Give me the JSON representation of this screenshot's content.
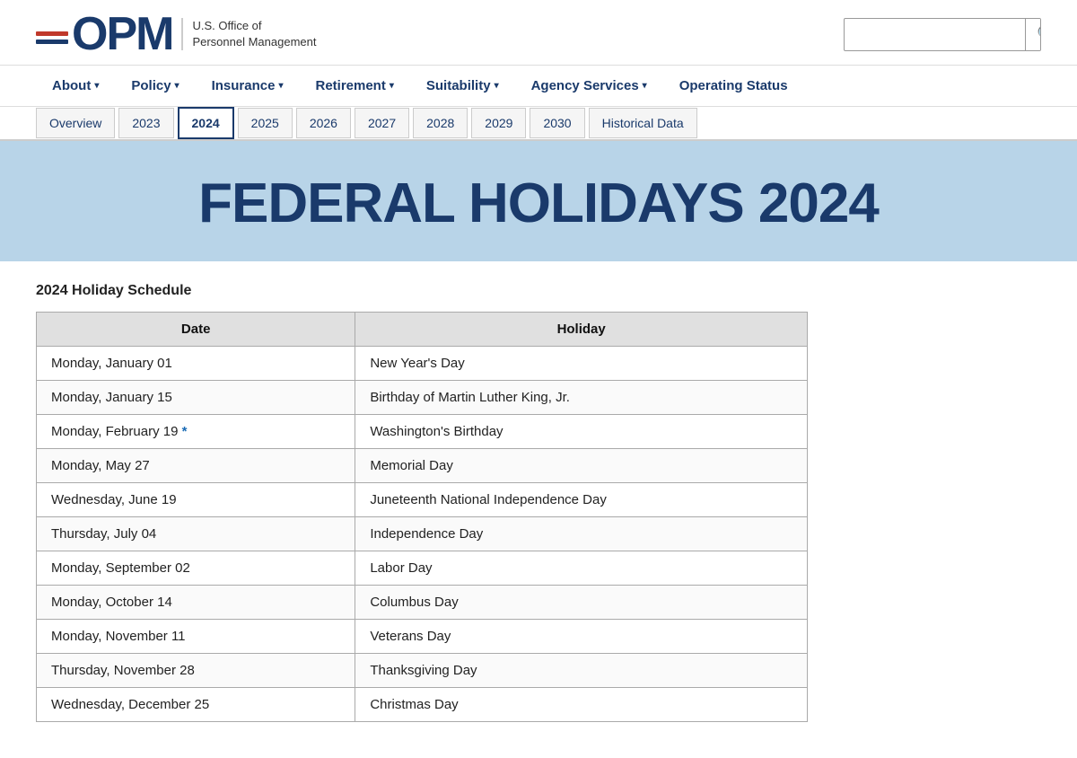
{
  "header": {
    "logo_text": "OPM",
    "tagline_line1": "U.S. Office of",
    "tagline_line2": "Personnel Management",
    "search_placeholder": "",
    "search_icon": "🔍"
  },
  "nav": {
    "items": [
      {
        "id": "about",
        "label": "About",
        "hasDropdown": true
      },
      {
        "id": "policy",
        "label": "Policy",
        "hasDropdown": true
      },
      {
        "id": "insurance",
        "label": "Insurance",
        "hasDropdown": true
      },
      {
        "id": "retirement",
        "label": "Retirement",
        "hasDropdown": true
      },
      {
        "id": "suitability",
        "label": "Suitability",
        "hasDropdown": true
      },
      {
        "id": "agency-services",
        "label": "Agency Services",
        "hasDropdown": true
      },
      {
        "id": "operating-status",
        "label": "Operating Status",
        "hasDropdown": false
      }
    ]
  },
  "sub_nav": {
    "tabs": [
      {
        "id": "overview",
        "label": "Overview",
        "active": false
      },
      {
        "id": "2023",
        "label": "2023",
        "active": false
      },
      {
        "id": "2024",
        "label": "2024",
        "active": true
      },
      {
        "id": "2025",
        "label": "2025",
        "active": false
      },
      {
        "id": "2026",
        "label": "2026",
        "active": false
      },
      {
        "id": "2027",
        "label": "2027",
        "active": false
      },
      {
        "id": "2028",
        "label": "2028",
        "active": false
      },
      {
        "id": "2029",
        "label": "2029",
        "active": false
      },
      {
        "id": "2030",
        "label": "2030",
        "active": false
      },
      {
        "id": "historical-data",
        "label": "Historical Data",
        "active": false
      }
    ]
  },
  "hero": {
    "title": "FEDERAL HOLIDAYS 2024"
  },
  "content": {
    "schedule_title": "2024 Holiday Schedule",
    "table": {
      "col_date": "Date",
      "col_holiday": "Holiday",
      "rows": [
        {
          "date": "Monday, January 01",
          "holiday": "New Year's Day",
          "asterisk": false
        },
        {
          "date": "Monday, January 15",
          "holiday": "Birthday of Martin Luther King, Jr.",
          "asterisk": false
        },
        {
          "date": "Monday, February 19",
          "holiday": "Washington's Birthday",
          "asterisk": true
        },
        {
          "date": "Monday, May 27",
          "holiday": "Memorial Day",
          "asterisk": false
        },
        {
          "date": "Wednesday, June 19",
          "holiday": "Juneteenth National Independence Day",
          "asterisk": false
        },
        {
          "date": "Thursday, July 04",
          "holiday": "Independence Day",
          "asterisk": false
        },
        {
          "date": "Monday, September 02",
          "holiday": "Labor Day",
          "asterisk": false
        },
        {
          "date": "Monday, October 14",
          "holiday": "Columbus Day",
          "asterisk": false
        },
        {
          "date": "Monday, November 11",
          "holiday": "Veterans Day",
          "asterisk": false
        },
        {
          "date": "Thursday, November 28",
          "holiday": "Thanksgiving Day",
          "asterisk": false
        },
        {
          "date": "Wednesday, December 25",
          "holiday": "Christmas Day",
          "asterisk": false
        }
      ]
    }
  }
}
